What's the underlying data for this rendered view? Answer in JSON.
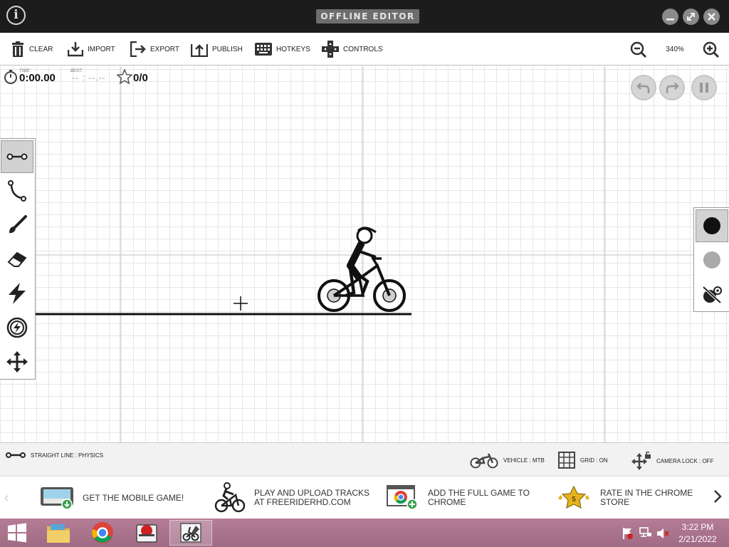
{
  "window": {
    "title": "OFFLINE EDITOR",
    "info_icon": "info-icon",
    "controls": [
      "minimize-icon",
      "maximize-icon",
      "close-icon"
    ]
  },
  "toolbar": {
    "clear": "CLEAR",
    "import": "IMPORT",
    "export": "EXPORT",
    "publish": "PUBLISH",
    "hotkeys": "HOTKEYS",
    "controls": "CONTROLS",
    "zoom": "340%"
  },
  "hud": {
    "time_label": "TIME:",
    "time": "0:00.00",
    "best_label": "BEST:",
    "best": "-- : --.--",
    "stars": "0/0"
  },
  "tools": [
    "straight-line-icon",
    "curve-icon",
    "brush-icon",
    "eraser-icon",
    "powerup-icon",
    "boost-icon",
    "move-icon"
  ],
  "colors": {
    "physics": "#111111",
    "scenery": "#aaaaaa",
    "accent_status": "#1a1a1a"
  },
  "statusbar": {
    "tool": "STRAIGHT LINE : PHYSICS",
    "vehicle": "VEHICLE : MTB",
    "grid": "GRID : ON",
    "camera": "CAMERA LOCK : OFF"
  },
  "promos": {
    "mobile": "GET THE MOBILE GAME!",
    "upload_1": "PLAY AND UPLOAD TRACKS",
    "upload_2": "AT FREERIDERHD.COM",
    "chrome_1": "ADD THE FULL GAME TO",
    "chrome_2": "CHROME",
    "rate_1": "RATE IN THE CHROME",
    "rate_2": "STORE",
    "rate_badge": "5"
  },
  "taskbar": {
    "time": "3:22 PM",
    "date": "2/21/2022"
  }
}
